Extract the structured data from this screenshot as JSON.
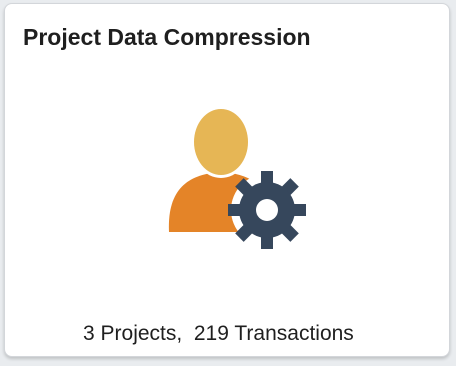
{
  "tile": {
    "title": "Project Data Compression",
    "icon": "user-gear-icon",
    "summary": "3 Projects,  219 Transactions"
  },
  "colors": {
    "head": "#e6b655",
    "body": "#e48428",
    "gear": "#36475c",
    "background": "#ffffff"
  }
}
